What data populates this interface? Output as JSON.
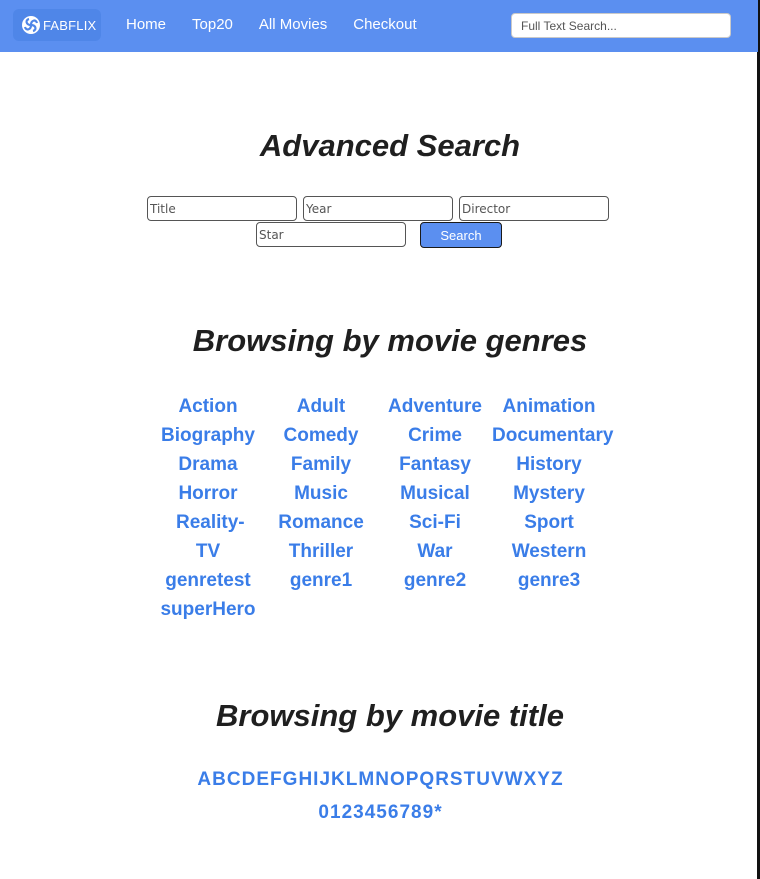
{
  "brand": {
    "name": "FABFLIX",
    "logo_icon": "swirl-logo-icon"
  },
  "nav": {
    "items": [
      "Home",
      "Top20",
      "All Movies",
      "Checkout"
    ]
  },
  "full_text_search": {
    "placeholder": "Full Text Search..."
  },
  "advanced_search": {
    "heading": "Advanced Search",
    "title_placeholder": "Title",
    "year_placeholder": "Year",
    "director_placeholder": "Director",
    "star_placeholder": "Star",
    "button_label": "Search"
  },
  "genres": {
    "heading": "Browsing by movie genres",
    "items": [
      "Action",
      "Adult",
      "Adventure",
      "Animation",
      "Biography",
      "Comedy",
      "Crime",
      "Documentary",
      "Drama",
      "Family",
      "Fantasy",
      "History",
      "Horror",
      "Music",
      "Musical",
      "Mystery",
      "Reality-TV",
      "Romance",
      "Sci-Fi",
      "Sport",
      "Thriller",
      "War",
      "Western",
      "genretest",
      "genre1",
      "genre2",
      "genre3",
      "superHero"
    ]
  },
  "titles": {
    "heading": "Browsing by movie title",
    "letters": [
      "A",
      "B",
      "C",
      "D",
      "E",
      "F",
      "G",
      "H",
      "I",
      "J",
      "K",
      "L",
      "M",
      "N",
      "O",
      "P",
      "Q",
      "R",
      "S",
      "T",
      "U",
      "V",
      "W",
      "X",
      "Y",
      "Z"
    ],
    "digits": [
      "0",
      "1",
      "2",
      "3",
      "4",
      "5",
      "6",
      "7",
      "8",
      "9",
      "*"
    ]
  },
  "colors": {
    "navbar": "#5b8ff0",
    "link": "#3a7de8",
    "heading": "#1f1f1f"
  }
}
